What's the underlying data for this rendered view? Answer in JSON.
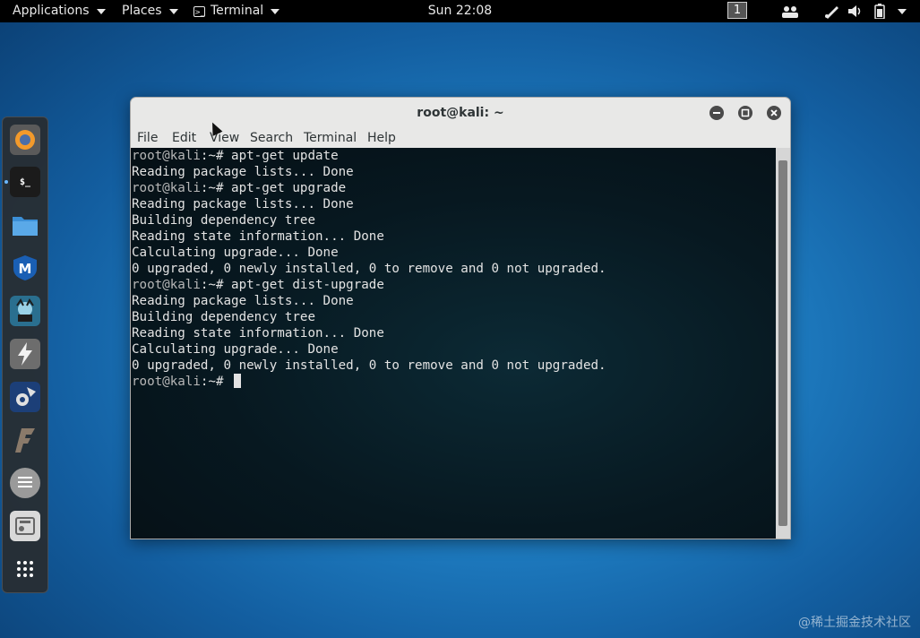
{
  "topbar": {
    "applications": "Applications",
    "places": "Places",
    "terminal": "Terminal",
    "clock": "Sun 22:08",
    "workspace": "1",
    "icons": [
      "people-icon",
      "network-pen-icon",
      "volume-icon",
      "battery-icon",
      "chevron-down-icon"
    ]
  },
  "dock": {
    "items": [
      {
        "name": "firefox-icon",
        "color": "#5a5a5a"
      },
      {
        "name": "terminal-icon",
        "color": "#1b1b1b",
        "label": "$_"
      },
      {
        "name": "files-icon",
        "color": "#3b8fd6"
      },
      {
        "name": "metasploit-icon",
        "color": "#1a5fb4",
        "label": "M"
      },
      {
        "name": "armitage-icon",
        "color": "#2a6f8f"
      },
      {
        "name": "burpsuite-icon",
        "color": "#6d6d6d"
      },
      {
        "name": "maltego-icon",
        "color": "#1c3f78"
      },
      {
        "name": "faraday-icon",
        "color": "#8a7a6a"
      },
      {
        "name": "leafpad-icon",
        "color": "#9a9a9a"
      },
      {
        "name": "settings-icon",
        "color": "#b9b9b9"
      },
      {
        "name": "show-apps-icon",
        "color": "transparent"
      }
    ]
  },
  "window": {
    "title": "root@kali: ~",
    "menu": [
      "File",
      "Edit",
      "View",
      "Search",
      "Terminal",
      "Help"
    ]
  },
  "terminal": {
    "prompt": "root@kali:~# ",
    "lines": [
      {
        "prompt": "root@kali",
        "path": ":~# ",
        "text": "apt-get update"
      },
      {
        "text": "Reading package lists... Done"
      },
      {
        "prompt": "root@kali",
        "path": ":~# ",
        "text": "apt-get upgrade"
      },
      {
        "text": "Reading package lists... Done"
      },
      {
        "text": "Building dependency tree"
      },
      {
        "text": "Reading state information... Done"
      },
      {
        "text": "Calculating upgrade... Done"
      },
      {
        "text": "0 upgraded, 0 newly installed, 0 to remove and 0 not upgraded."
      },
      {
        "prompt": "root@kali",
        "path": ":~# ",
        "text": "apt-get dist-upgrade"
      },
      {
        "text": "Reading package lists... Done"
      },
      {
        "text": "Building dependency tree"
      },
      {
        "text": "Reading state information... Done"
      },
      {
        "text": "Calculating upgrade... Done"
      },
      {
        "text": "0 upgraded, 0 newly installed, 0 to remove and 0 not upgraded."
      },
      {
        "prompt": "root@kali",
        "path": ":~# ",
        "text": "",
        "cursor": true
      }
    ]
  },
  "watermark": "@稀土掘金技术社区"
}
